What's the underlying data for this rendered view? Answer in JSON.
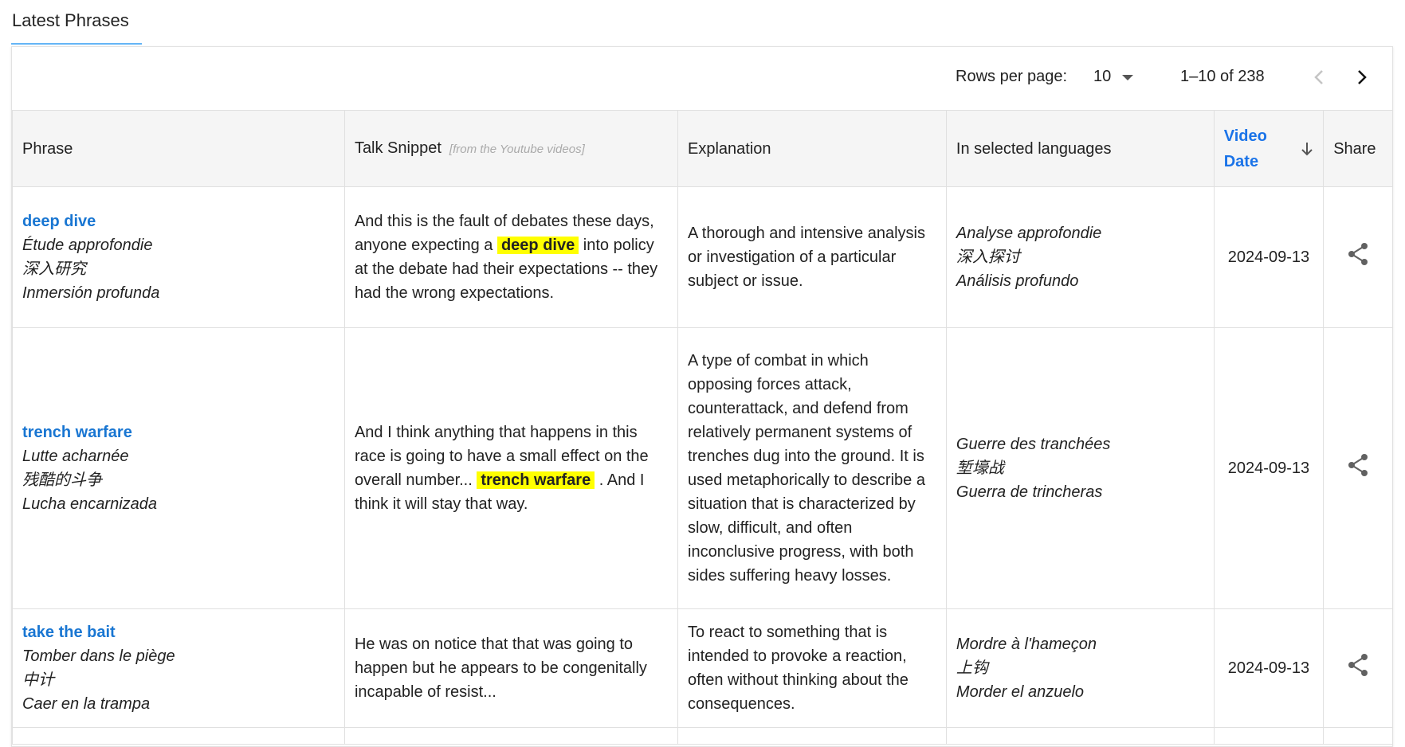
{
  "tab": {
    "label": "Latest Phrases"
  },
  "pagination": {
    "rows_per_page_label": "Rows per page:",
    "rows_per_page_value": "10",
    "range": "1–10 of 238"
  },
  "columns": {
    "phrase": "Phrase",
    "snippet": "Talk Snippet",
    "snippet_hint": "[from the Youtube videos]",
    "explanation": "Explanation",
    "languages": "In selected languages",
    "video_date": "Video Date",
    "share": "Share"
  },
  "rows": [
    {
      "phrase": "deep dive",
      "phrase_translations": [
        "Étude approfondie",
        "深入研究",
        "Inmersión profunda"
      ],
      "snippet_before": "And this is the fault of debates these days, anyone expecting a",
      "snippet_highlight": "deep dive",
      "snippet_after": "into policy at the debate had their expectations -- they had the wrong expectations.",
      "explanation": "A thorough and intensive analysis or investigation of a particular subject or issue.",
      "languages": [
        "Analyse approfondie",
        "深入探讨",
        "Análisis profundo"
      ],
      "date": "2024-09-13"
    },
    {
      "phrase": "trench warfare",
      "phrase_translations": [
        "Lutte acharnée",
        "残酷的斗争",
        "Lucha encarnizada"
      ],
      "snippet_before": "And I think anything that happens in this race is going to have a small effect on the overall number...",
      "snippet_highlight": "trench warfare",
      "snippet_after": ". And I think it will stay that way.",
      "explanation": "A type of combat in which opposing forces attack, counterattack, and defend from relatively permanent systems of trenches dug into the ground. It is used metaphorically to describe a situation that is characterized by slow, difficult, and often inconclusive progress, with both sides suffering heavy losses.",
      "languages": [
        "Guerre des tranchées",
        "堑壕战",
        "Guerra de trincheras"
      ],
      "date": "2024-09-13"
    },
    {
      "phrase": "take the bait",
      "phrase_translations": [
        "Tomber dans le piège",
        "中计",
        "Caer en la trampa"
      ],
      "snippet_before": "He was on notice that that was going to happen but he appears to be congenitally incapable of resist...",
      "snippet_highlight": "",
      "snippet_after": "",
      "explanation": "To react to something that is intended to provoke a reaction, often without thinking about the consequences.",
      "languages": [
        "Mordre à l'hameçon",
        "上钩",
        "Morder el anzuelo"
      ],
      "date": "2024-09-13"
    }
  ],
  "icons": {
    "share": "share-icon",
    "sort": "arrow-down-icon",
    "prev": "chevron-left-icon",
    "next": "chevron-right-icon",
    "dropdown": "caret-down-icon"
  },
  "colors": {
    "accent": "#1976d2",
    "highlight": "#ffff00",
    "header_bg": "#f5f5f5",
    "tab_underline": "#64b5f6"
  }
}
